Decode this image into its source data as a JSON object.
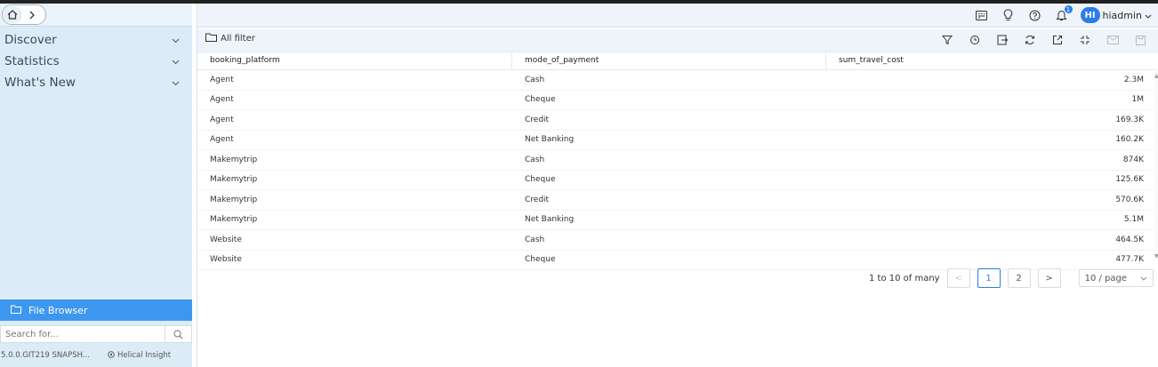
{
  "sidebar": {
    "nav": [
      {
        "label": "Discover"
      },
      {
        "label": "Statistics"
      },
      {
        "label": "What's New"
      }
    ],
    "file_browser_label": "File Browser",
    "search_placeholder": "Search for...",
    "version": "5.0.0.GIT219 SNAPSH...",
    "brand": "Helical Insight"
  },
  "header": {
    "notification_count": "1",
    "avatar_initials": "HI",
    "username": "hiadmin"
  },
  "toolbar": {
    "all_filter_label": "All filter"
  },
  "table": {
    "columns": [
      "booking_platform",
      "mode_of_payment",
      "sum_travel_cost"
    ],
    "rows": [
      [
        "Agent",
        "Cash",
        "2.3M"
      ],
      [
        "Agent",
        "Cheque",
        "1M"
      ],
      [
        "Agent",
        "Credit",
        "169.3K"
      ],
      [
        "Agent",
        "Net Banking",
        "160.2K"
      ],
      [
        "Makemytrip",
        "Cash",
        "874K"
      ],
      [
        "Makemytrip",
        "Cheque",
        "125.6K"
      ],
      [
        "Makemytrip",
        "Credit",
        "570.6K"
      ],
      [
        "Makemytrip",
        "Net Banking",
        "5.1M"
      ],
      [
        "Website",
        "Cash",
        "464.5K"
      ],
      [
        "Website",
        "Cheque",
        "477.7K"
      ]
    ]
  },
  "pagination": {
    "summary": "1 to 10 of many",
    "pages": [
      "1",
      "2"
    ],
    "current_page": "1",
    "page_size": "10 / page"
  },
  "colors": {
    "accent": "#3e97ee",
    "sidebar_bg": "#dcecf7",
    "header_bg": "#eef4f9"
  }
}
